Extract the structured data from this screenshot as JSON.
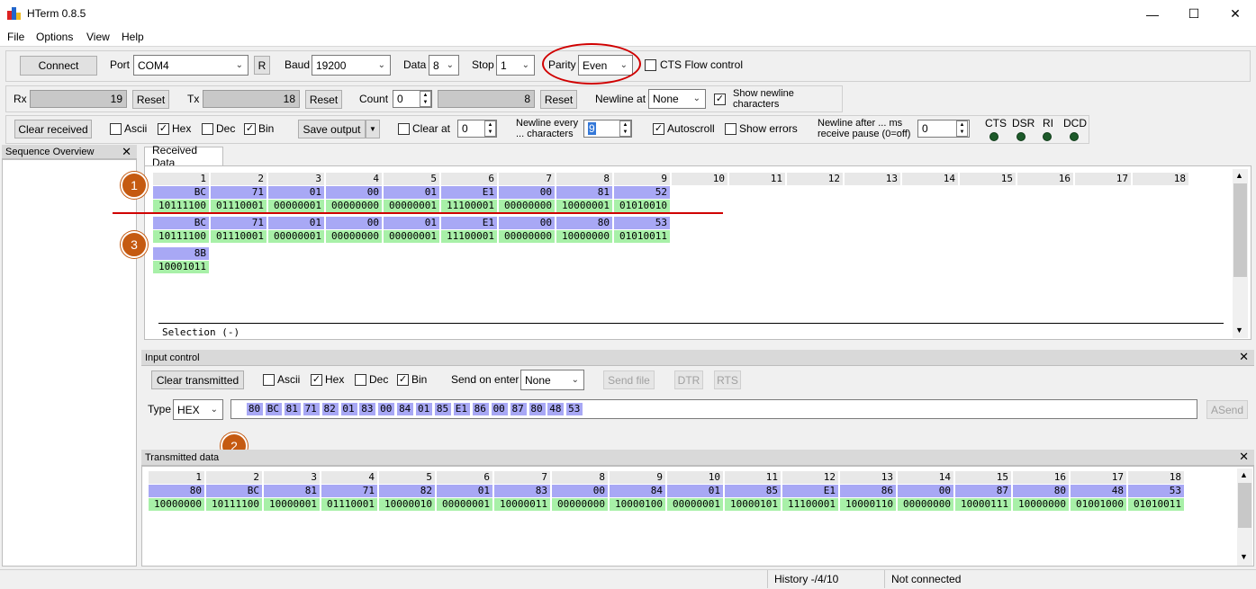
{
  "window": {
    "title": "HTerm 0.8.5",
    "minimize": "—",
    "maximize": "☐",
    "close": "✕"
  },
  "menu": [
    "File",
    "Options",
    "View",
    "Help"
  ],
  "connection": {
    "connect_label": "Connect",
    "port_label": "Port",
    "port_value": "COM4",
    "r_label": "R",
    "baud_label": "Baud",
    "baud_value": "19200",
    "data_label": "Data",
    "data_value": "8",
    "stop_label": "Stop",
    "stop_value": "1",
    "parity_label": "Parity",
    "parity_value": "Even",
    "cts_label": "CTS Flow control"
  },
  "counters": {
    "rx_label": "Rx",
    "rx_value": "19",
    "rx_reset": "Reset",
    "tx_label": "Tx",
    "tx_value": "18",
    "tx_reset": "Reset",
    "count_label": "Count",
    "count_input": "0",
    "count_value": "8",
    "count_reset": "Reset",
    "newline_at_label": "Newline at",
    "newline_at_value": "None",
    "show_newline_label": "Show newline characters"
  },
  "recv_toolbar": {
    "clear_received": "Clear received",
    "ascii": "Ascii",
    "hex": "Hex",
    "dec": "Dec",
    "bin": "Bin",
    "save_output": "Save output",
    "clear_at": "Clear at",
    "clear_at_value": "0",
    "newline_every": "Newline every ... characters",
    "newline_every_value": "9",
    "autoscroll": "Autoscroll",
    "show_errors": "Show errors",
    "newline_after": "Newline after ... ms receive pause (0=off)",
    "newline_after_value": "0",
    "signals": [
      "CTS",
      "DSR",
      "RI",
      "DCD"
    ]
  },
  "sequence_overview": {
    "title": "Sequence Overview",
    "close": "✕"
  },
  "received": {
    "tab_label": "Received Data",
    "columns": [
      "1",
      "2",
      "3",
      "4",
      "5",
      "6",
      "7",
      "8",
      "9",
      "10",
      "11",
      "12",
      "13",
      "14",
      "15",
      "16",
      "17",
      "18"
    ],
    "rows": [
      {
        "hex": [
          "BC",
          "71",
          "01",
          "00",
          "01",
          "E1",
          "00",
          "81",
          "52"
        ],
        "bin": [
          "10111100",
          "01110001",
          "00000001",
          "00000000",
          "00000001",
          "11100001",
          "00000000",
          "10000001",
          "01010010"
        ]
      },
      {
        "hex": [
          "BC",
          "71",
          "01",
          "00",
          "01",
          "E1",
          "00",
          "80",
          "53"
        ],
        "bin": [
          "10111100",
          "01110001",
          "00000001",
          "00000000",
          "00000001",
          "11100001",
          "00000000",
          "10000000",
          "01010011"
        ]
      },
      {
        "hex": [
          "8B"
        ],
        "bin": [
          "10001011"
        ]
      }
    ],
    "selection": "Selection (-)"
  },
  "input_control": {
    "title": "Input control",
    "close": "✕",
    "clear_transmitted": "Clear transmitted",
    "ascii": "Ascii",
    "hex": "Hex",
    "dec": "Dec",
    "bin": "Bin",
    "send_on_enter_label": "Send on enter",
    "send_on_enter_value": "None",
    "send_file": "Send file",
    "dtr": "DTR",
    "rts": "RTS",
    "type_label": "Type",
    "type_value": "HEX",
    "input_tokens": [
      "80",
      "BC",
      "81",
      "71",
      "82",
      "01",
      "83",
      "00",
      "84",
      "01",
      "85",
      "E1",
      "86",
      "00",
      "87",
      "80",
      "48",
      "53"
    ],
    "asend": "ASend"
  },
  "transmitted": {
    "title": "Transmitted data",
    "close": "✕",
    "columns": [
      "1",
      "2",
      "3",
      "4",
      "5",
      "6",
      "7",
      "8",
      "9",
      "10",
      "11",
      "12",
      "13",
      "14",
      "15",
      "16",
      "17",
      "18"
    ],
    "hex": [
      "80",
      "BC",
      "81",
      "71",
      "82",
      "01",
      "83",
      "00",
      "84",
      "01",
      "85",
      "E1",
      "86",
      "00",
      "87",
      "80",
      "48",
      "53"
    ],
    "bin": [
      "10000000",
      "10111100",
      "10000001",
      "01110001",
      "10000010",
      "00000001",
      "10000011",
      "00000000",
      "10000100",
      "00000001",
      "10000101",
      "11100001",
      "10000110",
      "00000000",
      "10000111",
      "10000000",
      "01001000",
      "01010011"
    ]
  },
  "annotations": [
    "1",
    "2",
    "3"
  ],
  "status": {
    "history": "History -/4/10",
    "connection": "Not connected"
  },
  "colors": {
    "hex_cell": "#a8a8f5",
    "bin_cell": "#a8f0a8",
    "badge": "#c55a11",
    "annotation_line": "#d00000"
  }
}
